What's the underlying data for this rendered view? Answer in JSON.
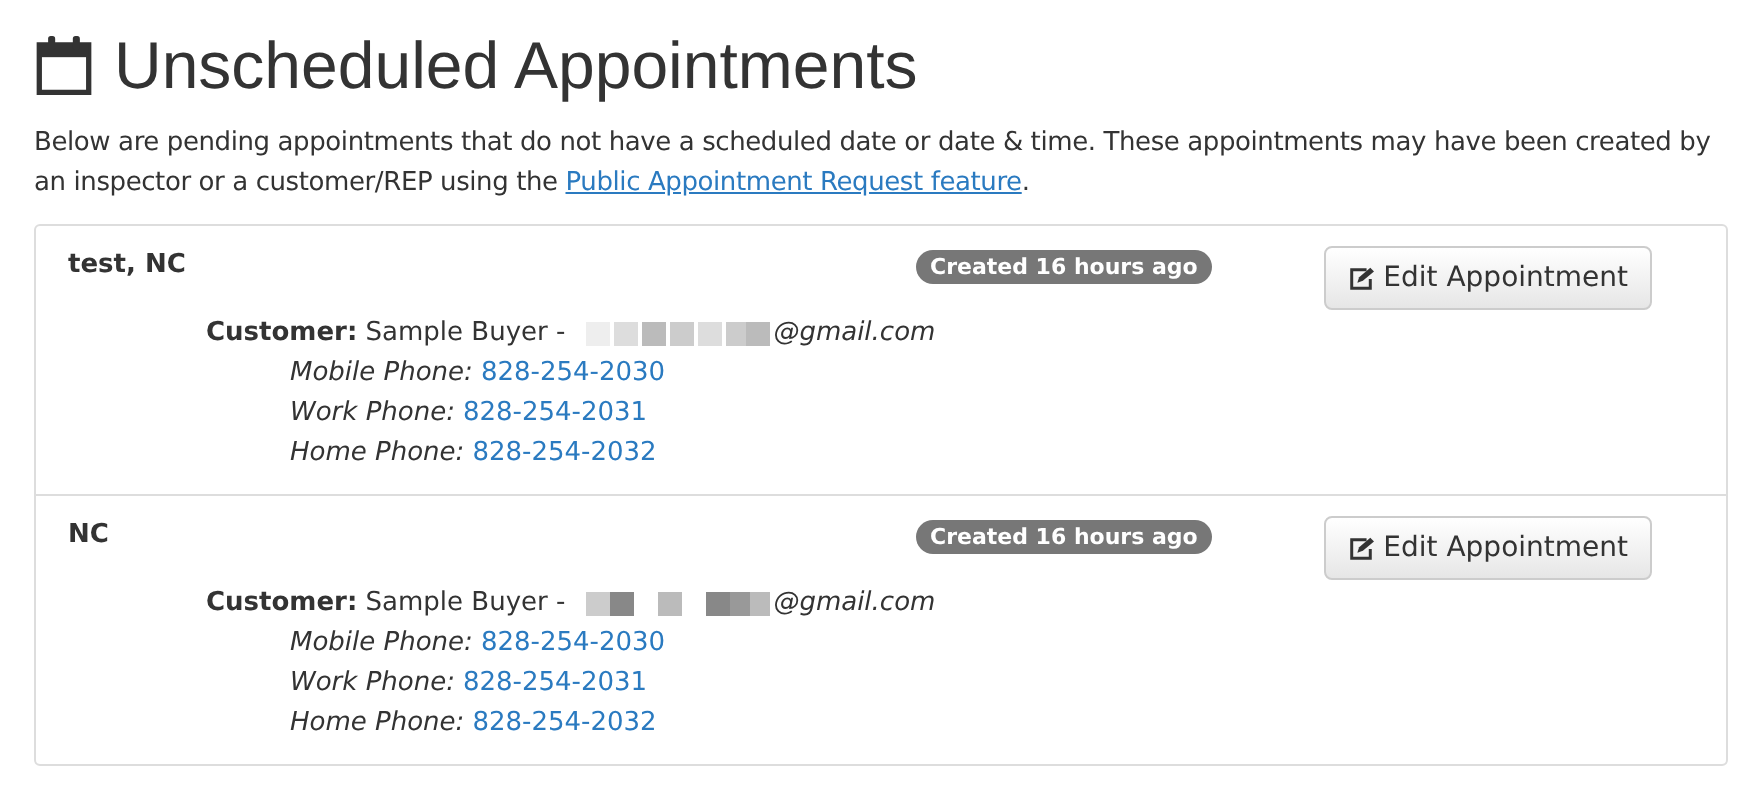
{
  "title": "Unscheduled Appointments",
  "intro": {
    "text": "Below are pending appointments that do not have a scheduled date or date & time. These appointments may have been created by an inspector or a customer/REP using the ",
    "link": "Public Appointment Request feature",
    "end": "."
  },
  "appointments": [
    {
      "name": "test, NC",
      "badge": "Created 16 hours ago",
      "button": "Edit Appointment",
      "customer_label": "Customer:",
      "customer": "Sample Buyer -",
      "email": "@gmail.com",
      "phones": [
        {
          "label": "Mobile Phone:",
          "number": "828-254-2030"
        },
        {
          "label": "Work Phone:",
          "number": "828-254-2031"
        },
        {
          "label": "Home Phone:",
          "number": "828-254-2032"
        }
      ]
    },
    {
      "name": "NC",
      "badge": "Created 16 hours ago",
      "button": "Edit Appointment",
      "customer_label": "Customer:",
      "customer": "Sample Buyer -",
      "email": "@gmail.com",
      "phones": [
        {
          "label": "Mobile Phone:",
          "number": "828-254-2030"
        },
        {
          "label": "Work Phone:",
          "number": "828-254-2031"
        },
        {
          "label": "Home Phone:",
          "number": "828-254-2032"
        }
      ]
    }
  ]
}
